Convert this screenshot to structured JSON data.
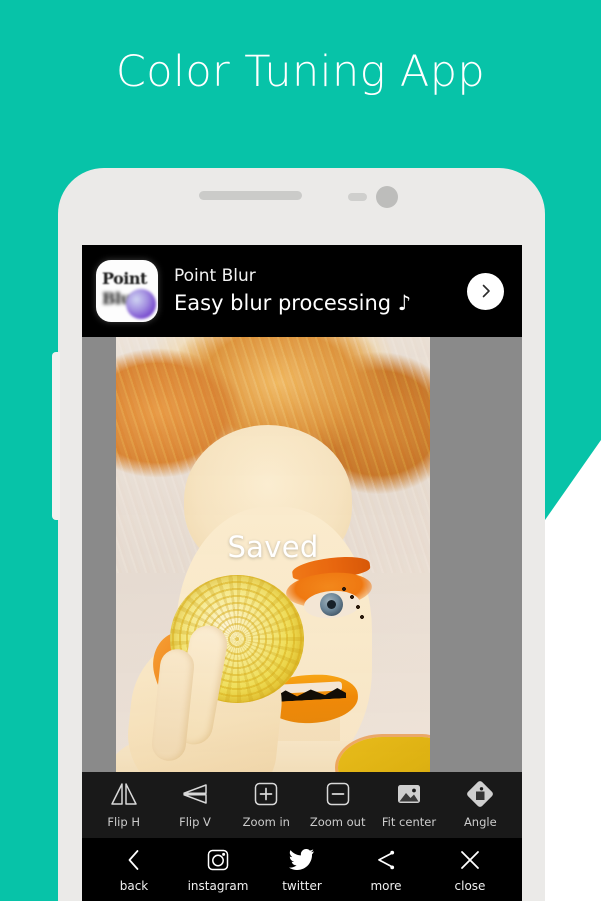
{
  "page": {
    "title": "Color Tuning App",
    "accent_color": "#07c3a8",
    "phone_body_color": "#ebeae8",
    "screen_bg_color": "#000000",
    "photo_backdrop_color": "#8a8a8a"
  },
  "ad": {
    "icon_line1": "Point",
    "icon_line2": "Blur",
    "title": "Point Blur",
    "subtitle": "Easy blur processing ♪",
    "cta_icon": "chevron-right-icon"
  },
  "canvas": {
    "status_text": "Saved"
  },
  "toolbar": {
    "items": [
      {
        "label": "Flip H",
        "icon": "flip-horizontal-icon"
      },
      {
        "label": "Flip V",
        "icon": "flip-vertical-icon"
      },
      {
        "label": "Zoom in",
        "icon": "zoom-in-icon"
      },
      {
        "label": "Zoom out",
        "icon": "zoom-out-icon"
      },
      {
        "label": "Fit center",
        "icon": "fit-center-icon"
      },
      {
        "label": "Angle",
        "icon": "angle-rotate-icon"
      }
    ]
  },
  "sharebar": {
    "items": [
      {
        "label": "back",
        "icon": "chevron-left-icon"
      },
      {
        "label": "instagram",
        "icon": "instagram-icon"
      },
      {
        "label": "twitter",
        "icon": "twitter-bird-icon"
      },
      {
        "label": "more",
        "icon": "share-icon"
      },
      {
        "label": "close",
        "icon": "close-x-icon"
      }
    ]
  }
}
